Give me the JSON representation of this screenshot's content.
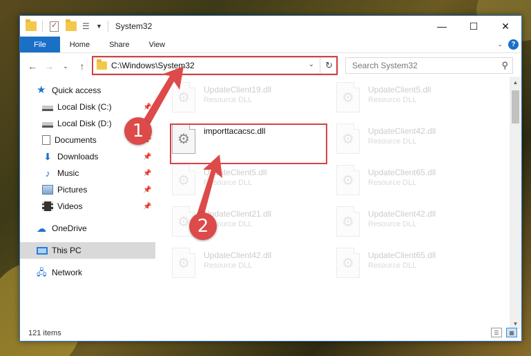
{
  "window": {
    "title": "System32",
    "minimize_label": "—",
    "maximize_label": "☐",
    "close_label": "✕"
  },
  "ribbon": {
    "tabs": [
      "File",
      "Home",
      "Share",
      "View"
    ],
    "collapse_icon": "chevron-down",
    "help_label": "?"
  },
  "nav": {
    "back": "←",
    "forward": "→",
    "recent": "⌄",
    "up": "↑",
    "address": "C:\\Windows\\System32",
    "search_placeholder": "Search System32"
  },
  "sidebar": {
    "items": [
      {
        "label": "Quick access",
        "icon": "star-icon"
      },
      {
        "label": "Local Disk (C:)",
        "icon": "drive-icon",
        "pinned": true
      },
      {
        "label": "Local Disk (D:)",
        "icon": "drive-icon",
        "pinned": false
      },
      {
        "label": "Documents",
        "icon": "document-icon",
        "pinned": true
      },
      {
        "label": "Downloads",
        "icon": "download-icon",
        "pinned": true
      },
      {
        "label": "Music",
        "icon": "music-icon",
        "pinned": true
      },
      {
        "label": "Pictures",
        "icon": "pictures-icon",
        "pinned": true
      },
      {
        "label": "Videos",
        "icon": "videos-icon",
        "pinned": true
      },
      {
        "label": "OneDrive",
        "icon": "cloud-icon"
      },
      {
        "label": "This PC",
        "icon": "computer-icon",
        "selected": true
      },
      {
        "label": "Network",
        "icon": "network-icon"
      }
    ]
  },
  "files": {
    "highlighted": {
      "name": "importtacacsc.dll"
    },
    "faded": [
      {
        "name": "UpdateClient19.dll",
        "type": "Resource DLL"
      },
      {
        "name": "UpdateClient5.dll",
        "type": "Resource DLL"
      },
      {
        "name": "UpdateClient42.dll",
        "type": "Resource DLL"
      },
      {
        "name": "UpdateClient5.dll",
        "type": "Resource DLL"
      },
      {
        "name": "UpdateClient65.dll",
        "type": "Resource DLL"
      },
      {
        "name": "UpdateClient21.dll",
        "type": "Resource DLL"
      },
      {
        "name": "UpdateClient42.dll",
        "type": "Resource DLL"
      },
      {
        "name": "UpdateClient42.dll",
        "type": "Resource DLL"
      },
      {
        "name": "UpdateClient65.dll",
        "type": "Resource DLL"
      }
    ]
  },
  "status": {
    "item_count": "121 items"
  },
  "annotations": {
    "step1": "1",
    "step2": "2",
    "highlight_color": "#d94040"
  }
}
